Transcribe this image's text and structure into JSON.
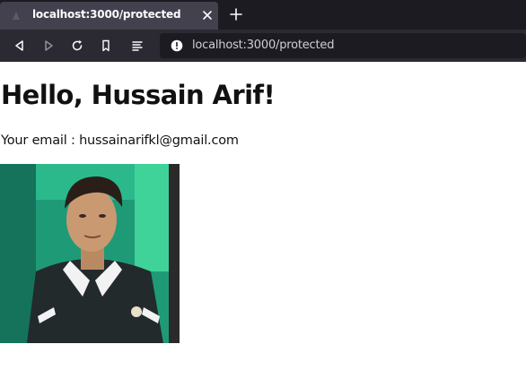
{
  "browser": {
    "tab": {
      "title": "localhost:3000/protected"
    },
    "url": "localhost:3000/protected",
    "icons": {
      "tab_favicon": "page-icon",
      "tab_close": "close-icon",
      "new_tab": "plus-icon",
      "back": "back-arrow-icon",
      "forward": "forward-arrow-icon",
      "reload": "reload-icon",
      "bookmark": "bookmark-icon",
      "reader": "reader-view-icon",
      "site_info": "info-icon"
    }
  },
  "page": {
    "greeting": "Hello, Hussain Arif!",
    "email_label": "Your email : ",
    "email": "hussainarifkl@gmail.com",
    "profile_image": "profile-photo"
  },
  "colors": {
    "tabbar_bg": "#1c1b22",
    "active_tab_bg": "#42414d",
    "navbar_bg": "#2b2a33",
    "urlbar_bg": "#1c1b22",
    "page_bg": "#ffffff",
    "text": "#111111"
  }
}
